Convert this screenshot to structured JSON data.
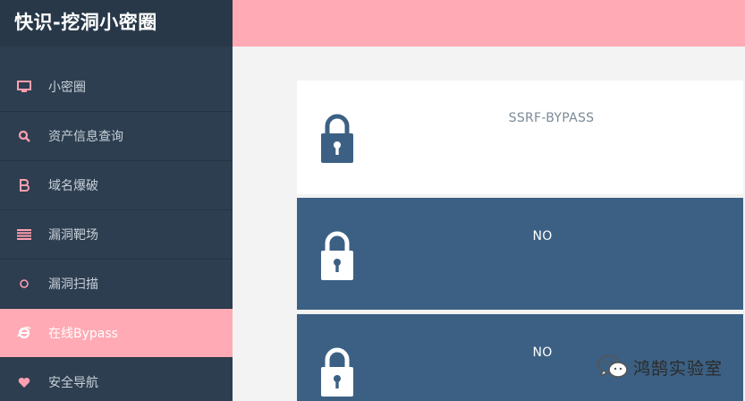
{
  "app": {
    "title": "快识-挖洞小密圈"
  },
  "sidebar": {
    "items": [
      {
        "label": "小密圈",
        "icon": "monitor-icon",
        "active": false
      },
      {
        "label": "资产信息查询",
        "icon": "search-icon",
        "active": false
      },
      {
        "label": "域名爆破",
        "icon": "bold-icon",
        "active": false
      },
      {
        "label": "漏洞靶场",
        "icon": "list-icon",
        "active": false
      },
      {
        "label": "漏洞扫描",
        "icon": "circle-icon",
        "active": false
      },
      {
        "label": "在线Bypass",
        "icon": "ie-icon",
        "active": true
      },
      {
        "label": "安全导航",
        "icon": "heart-icon",
        "active": false
      }
    ]
  },
  "cards": [
    {
      "title": "SSRF-BYPASS",
      "icon": "lock-icon"
    },
    {
      "title": "NO",
      "icon": "lock-icon"
    },
    {
      "title": "NO",
      "icon": "lock-icon"
    }
  ],
  "watermark": {
    "text": "鸿鹄实验室",
    "icon": "wechat-icon"
  },
  "colors": {
    "sidebar_bg": "#2d3e50",
    "accent_pink": "#ffaab4",
    "card_blue": "#3c6083"
  }
}
